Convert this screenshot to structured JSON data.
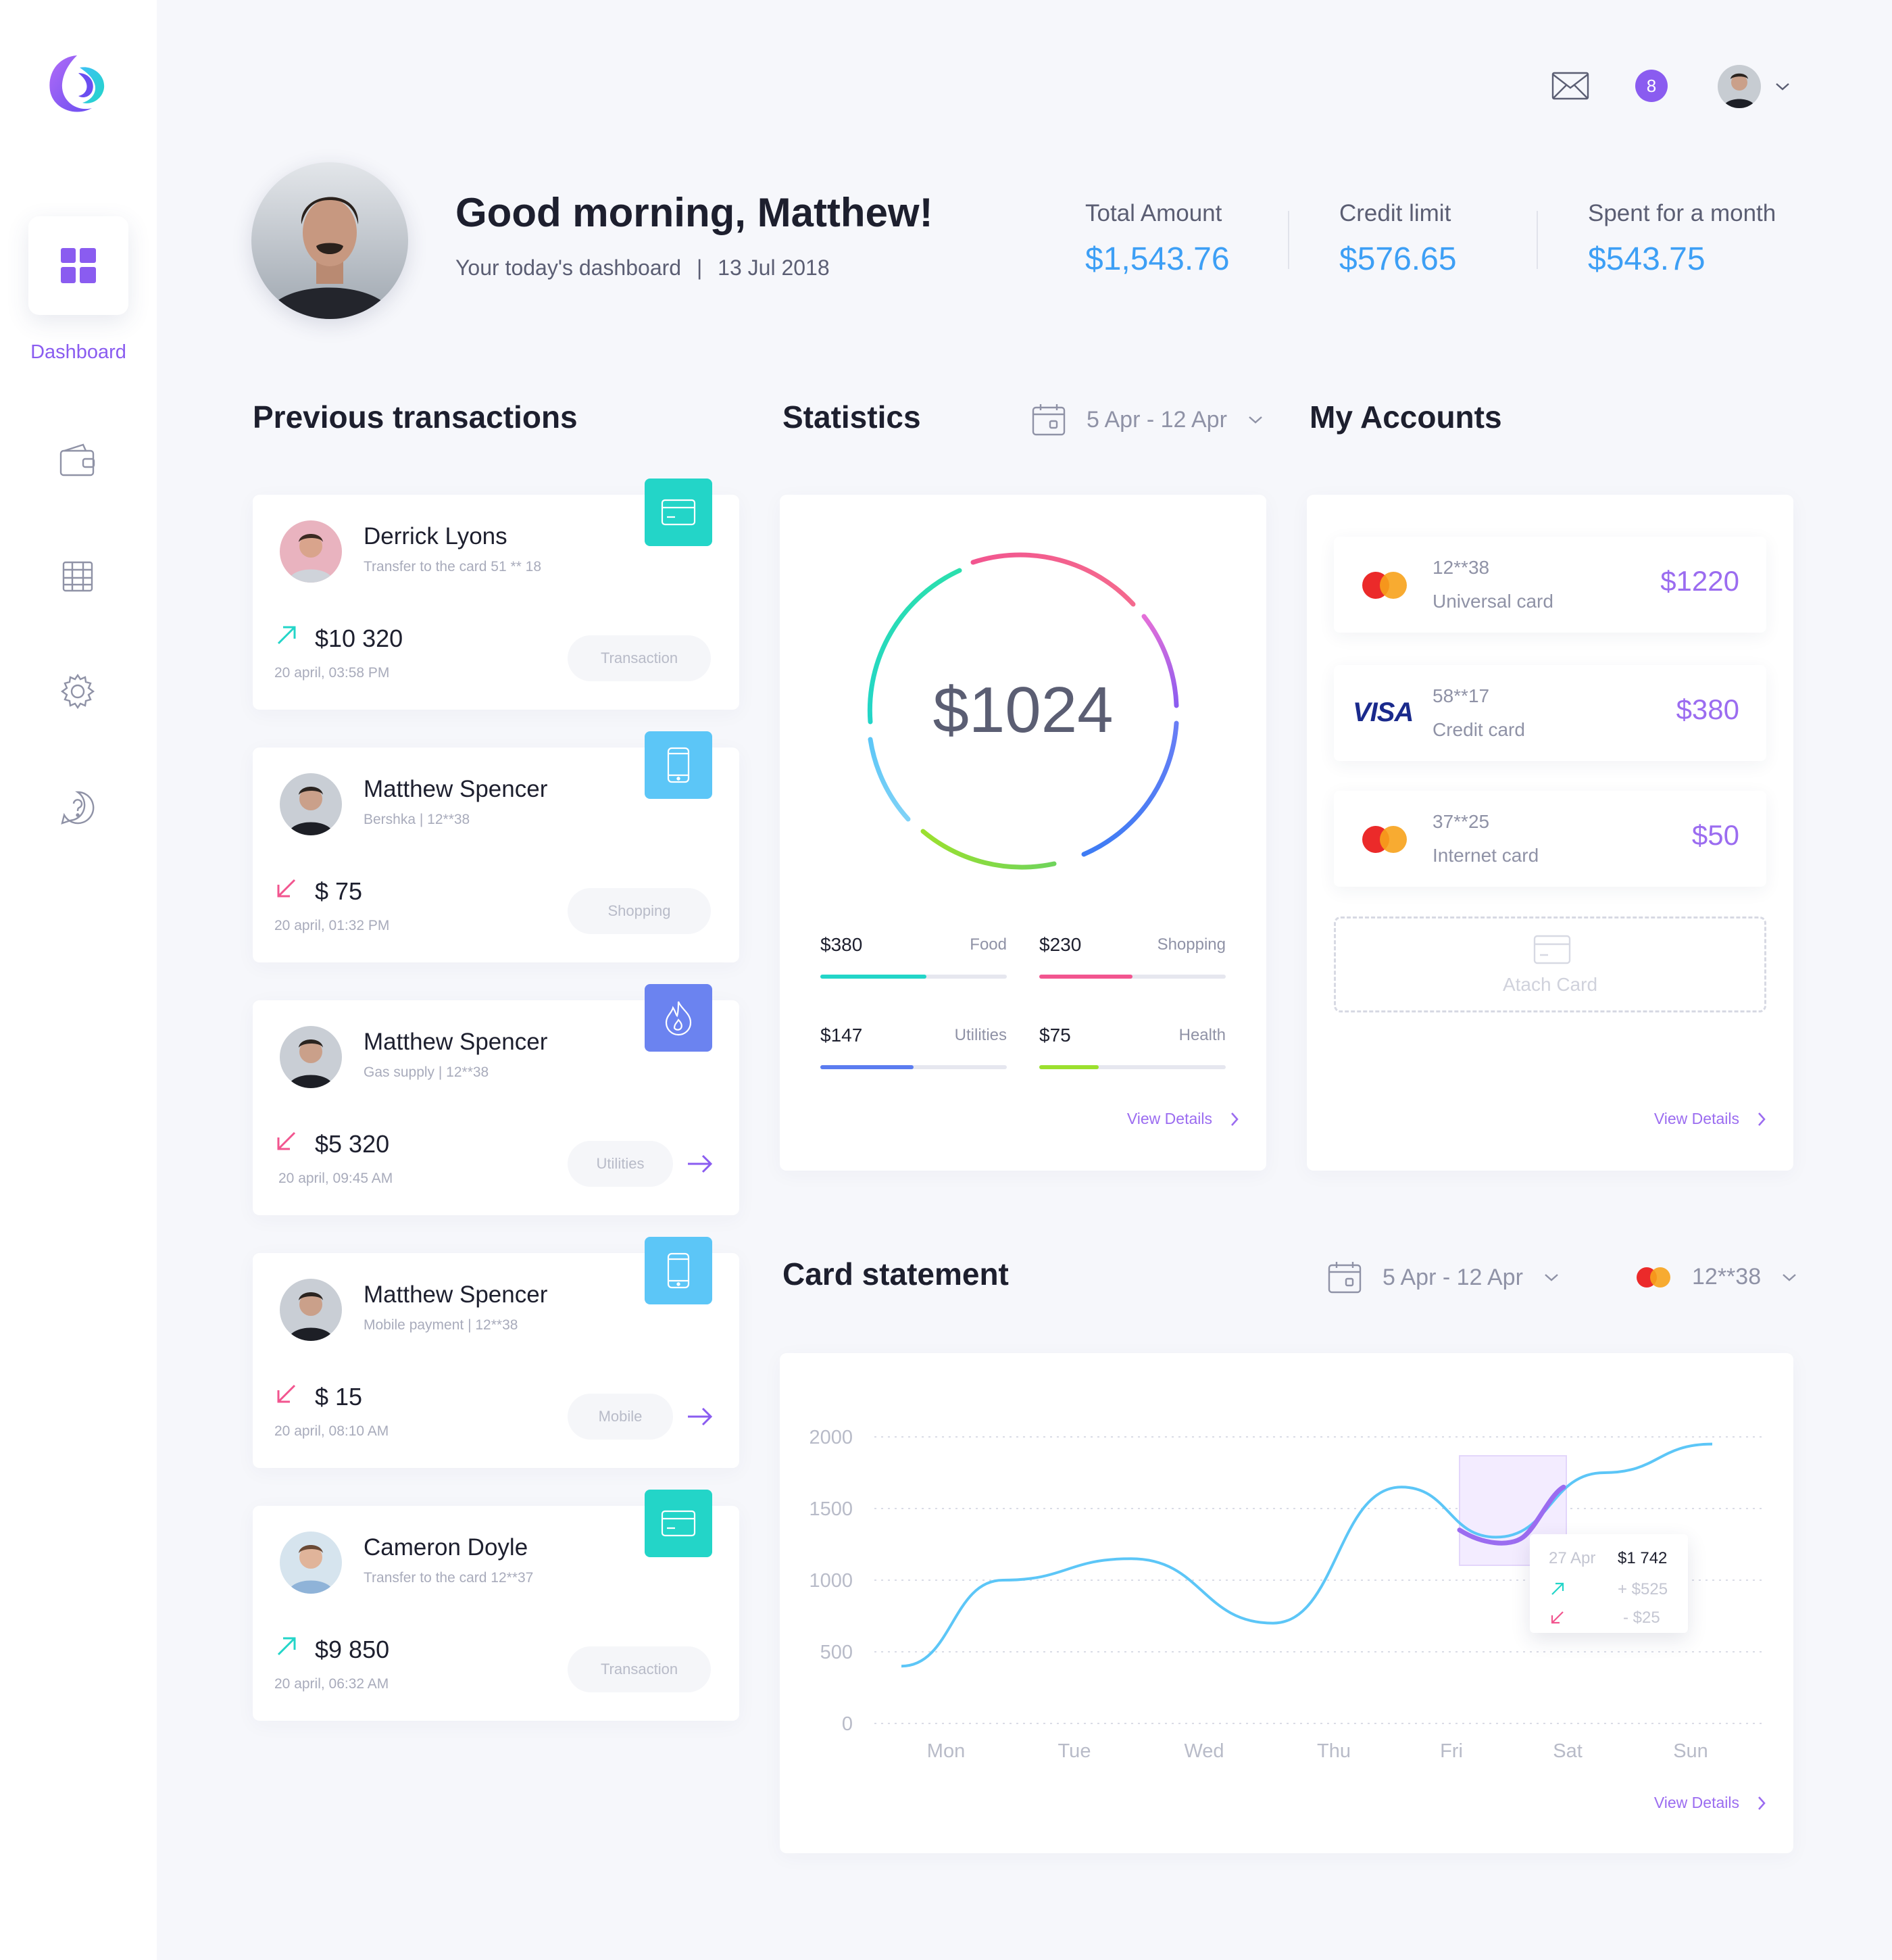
{
  "sidebar": {
    "items": [
      {
        "label": "Dashboard",
        "icon": "dashboard-icon",
        "active": true
      },
      {
        "label": "",
        "icon": "wallet-icon"
      },
      {
        "label": "",
        "icon": "calendar-table-icon"
      },
      {
        "label": "",
        "icon": "settings-gear-icon"
      },
      {
        "label": "",
        "icon": "help-question-icon"
      }
    ]
  },
  "topbar": {
    "notifications_count": "8"
  },
  "header": {
    "greeting": "Good morning, Matthew!",
    "subtitle": "Your today's dashboard",
    "separator": "|",
    "date": "13 Jul 2018",
    "summary": [
      {
        "label": "Total Amount",
        "value": "$1,543.76"
      },
      {
        "label": "Credit limit",
        "value": "$576.65"
      },
      {
        "label": "Spent for a month",
        "value": "$543.75"
      }
    ]
  },
  "transactions": {
    "title": "Previous transactions",
    "items": [
      {
        "name": "Derrick Lyons",
        "sub": "Transfer to the card 51 ** 18",
        "amount": "$10 320",
        "direction": "in",
        "date": "20 april, 03:58 PM",
        "tag": "Transaction",
        "badge_icon": "card-icon",
        "badge_color": "#23d5c8"
      },
      {
        "name": "Matthew Spencer",
        "sub": "Bershka | 12**38",
        "amount": "$ 75",
        "direction": "out",
        "date": "20 april, 01:32 PM",
        "tag": "Shopping",
        "badge_icon": "mobile-phone-icon",
        "badge_color": "#5cc6f7"
      },
      {
        "name": "Matthew Spencer",
        "sub": "Gas supply | 12**38",
        "amount": "$5 320",
        "direction": "out",
        "date": "20 april, 09:45 AM",
        "tag": "Utilities",
        "badge_icon": "flame-icon",
        "badge_color": "#6b83f0"
      },
      {
        "name": "Matthew Spencer",
        "sub": "Mobile payment | 12**38",
        "amount": "$ 15",
        "direction": "out",
        "date": "20 april, 08:10 AM",
        "tag": "Mobile",
        "badge_icon": "mobile-phone-icon",
        "badge_color": "#5cc6f7"
      },
      {
        "name": "Cameron Doyle",
        "sub": "Transfer to the card 12**37",
        "amount": "$9 850",
        "direction": "in",
        "date": "20 april, 06:32 AM",
        "tag": "Transaction",
        "badge_icon": "card-icon",
        "badge_color": "#23d5c8"
      }
    ]
  },
  "statistics": {
    "title": "Statistics",
    "date_range": "5 Apr - 12 Apr",
    "total": "$1024",
    "items": [
      {
        "value": "$380",
        "label": "Food",
        "color": "#23d5c8",
        "fill": 0.57
      },
      {
        "value": "$230",
        "label": "Shopping",
        "color": "#f2558f",
        "fill": 0.5
      },
      {
        "value": "$147",
        "label": "Utilities",
        "color": "#5b7cf0",
        "fill": 0.5
      },
      {
        "value": "$75",
        "label": "Health",
        "color": "#9be02e",
        "fill": 0.32
      }
    ],
    "view_details": "View Details"
  },
  "accounts": {
    "title": "My Accounts",
    "items": [
      {
        "number": "12**38",
        "name": "Universal card",
        "amount": "$1220",
        "brand": "mastercard-icon"
      },
      {
        "number": "58**17",
        "name": "Credit card",
        "amount": "$380",
        "brand": "VISA"
      },
      {
        "number": "37**25",
        "name": "Internet card",
        "amount": "$50",
        "brand": "mastercard-icon"
      }
    ],
    "attach_label": "Atach Card",
    "view_details": "View Details"
  },
  "card_statement": {
    "title": "Card statement",
    "date_range": "5 Apr - 12 Apr",
    "card": "12**38",
    "tooltip": {
      "date": "27 Apr",
      "amount": "$1 742",
      "plus": "+ $525",
      "minus": "- $25"
    },
    "view_details": "View Details"
  },
  "chart_data": {
    "type": "line",
    "x": [
      "Mon",
      "Tue",
      "Wed",
      "Thu",
      "Fri",
      "Sat",
      "Sun"
    ],
    "yticks": [
      "2000",
      "1500",
      "1000",
      "500",
      "0"
    ],
    "ylim": [
      0,
      2000
    ],
    "grid": true,
    "series": [
      {
        "values": [
          400,
          1000,
          1150,
          700,
          1650,
          1300,
          1750,
          1950
        ],
        "x_positions": [
          "start",
          "Mon-Tue",
          "Tue",
          "Wed",
          "Thu",
          "Fri",
          "Sat",
          "Sun"
        ]
      }
    ],
    "line_color": "#5cc6f7",
    "highlight_color": "#9b6cf0"
  }
}
